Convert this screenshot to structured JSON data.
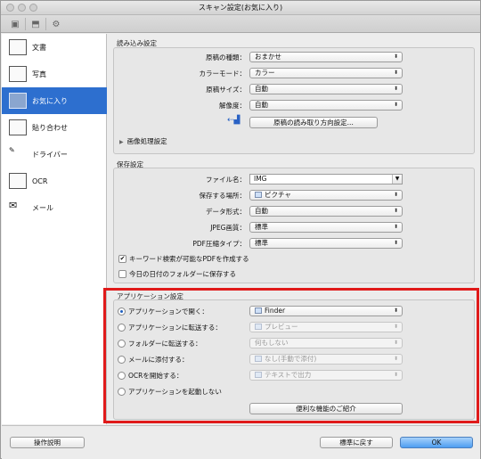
{
  "window": {
    "title": "スキャン設定(お気に入り)"
  },
  "sidebar": {
    "items": [
      {
        "label": "文書",
        "selected": false
      },
      {
        "label": "写真",
        "selected": false
      },
      {
        "label": "お気に入り",
        "selected": true
      },
      {
        "label": "貼り合わせ",
        "selected": false
      },
      {
        "label": "ドライバー",
        "selected": false
      },
      {
        "label": "OCR",
        "selected": false
      },
      {
        "label": "メール",
        "selected": false
      }
    ]
  },
  "read_settings": {
    "title": "読み込み設定",
    "doc_type": {
      "label": "原稿の種類：",
      "value": "おまかせ"
    },
    "color_mode": {
      "label": "カラーモード：",
      "value": "カラー"
    },
    "doc_size": {
      "label": "原稿サイズ：",
      "value": "自動"
    },
    "resolution": {
      "label": "解像度：",
      "value": "自動"
    },
    "orientation_button": "原稿の読み取り方向設定...",
    "image_processing": "画像処理設定"
  },
  "save_settings": {
    "title": "保存設定",
    "file_name": {
      "label": "ファイル名：",
      "value": "IMG"
    },
    "save_location": {
      "label": "保存する場所：",
      "value": "ピクチャ"
    },
    "data_format": {
      "label": "データ形式：",
      "value": "自動"
    },
    "jpeg_quality": {
      "label": "JPEG画質：",
      "value": "標準"
    },
    "pdf_compression": {
      "label": "PDF圧縮タイプ：",
      "value": "標準"
    },
    "keyword_pdf": {
      "label": "キーワード検索が可能なPDFを作成する",
      "checked": true
    },
    "date_folder": {
      "label": "今日の日付のフォルダーに保存する",
      "checked": false
    }
  },
  "app_settings": {
    "title": "アプリケーション設定",
    "options": [
      {
        "label": "アプリケーションで開く：",
        "selected": true,
        "value": "Finder",
        "enabled": true
      },
      {
        "label": "アプリケーションに転送する：",
        "selected": false,
        "value": "プレビュー",
        "enabled": false
      },
      {
        "label": "フォルダーに転送する：",
        "selected": false,
        "value": "何もしない",
        "enabled": false
      },
      {
        "label": "メールに添付する：",
        "selected": false,
        "value": "なし(手動で添付)",
        "enabled": false
      },
      {
        "label": "OCRを開始する：",
        "selected": false,
        "value": "テキストで出力",
        "enabled": false
      },
      {
        "label": "アプリケーションを起動しない",
        "selected": false
      }
    ],
    "features_button": "便利な機能のご紹介"
  },
  "footer": {
    "help_button": "操作説明",
    "defaults_button": "標準に戻す",
    "ok_button": "OK"
  },
  "colors": {
    "selection": "#2d6fcf",
    "highlight_box": "#e01a1a",
    "ok_button": "#4e9ef1"
  }
}
